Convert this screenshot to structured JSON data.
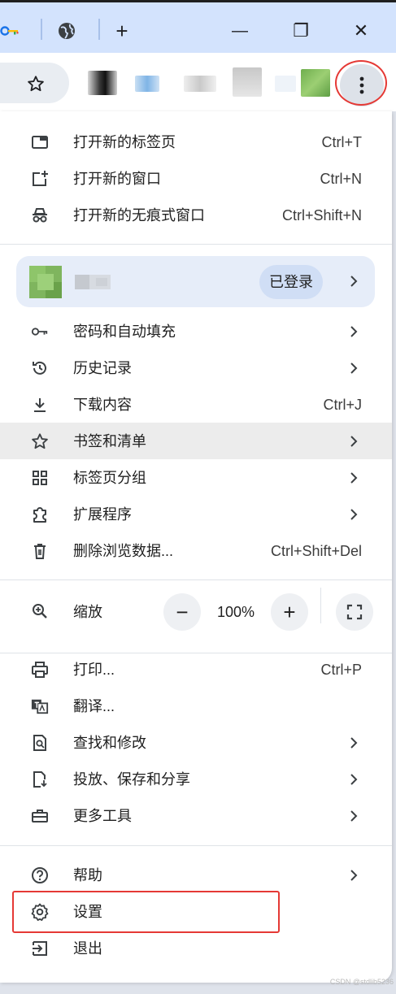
{
  "window_controls": {
    "new_tab": "+",
    "minimize": "—",
    "restore": "❐",
    "close": "✕"
  },
  "menu": {
    "group1": [
      {
        "icon": "new-tab-icon",
        "label": "打开新的标签页",
        "shortcut": "Ctrl+T"
      },
      {
        "icon": "new-window-icon",
        "label": "打开新的窗口",
        "shortcut": "Ctrl+N"
      },
      {
        "icon": "incognito-icon",
        "label": "打开新的无痕式窗口",
        "shortcut": "Ctrl+Shift+N"
      }
    ],
    "profile": {
      "status": "已登录"
    },
    "group2": [
      {
        "icon": "key-icon",
        "label": "密码和自动填充",
        "shortcut": ""
      },
      {
        "icon": "history-icon",
        "label": "历史记录",
        "shortcut": ""
      },
      {
        "icon": "download-icon",
        "label": "下载内容",
        "shortcut": "Ctrl+J"
      },
      {
        "icon": "star-icon",
        "label": "书签和清单",
        "shortcut": ""
      },
      {
        "icon": "tab-groups-icon",
        "label": "标签页分组",
        "shortcut": ""
      },
      {
        "icon": "extension-icon",
        "label": "扩展程序",
        "shortcut": ""
      },
      {
        "icon": "trash-icon",
        "label": "删除浏览数据...",
        "shortcut": "Ctrl+Shift+Del"
      }
    ],
    "zoom": {
      "label": "缩放",
      "minus": "−",
      "value": "100%",
      "plus": "+"
    },
    "group3": [
      {
        "icon": "print-icon",
        "label": "打印...",
        "shortcut": "Ctrl+P"
      },
      {
        "icon": "translate-icon",
        "label": "翻译...",
        "shortcut": ""
      },
      {
        "icon": "find-icon",
        "label": "查找和修改",
        "shortcut": ""
      },
      {
        "icon": "cast-icon",
        "label": "投放、保存和分享",
        "shortcut": ""
      },
      {
        "icon": "toolbox-icon",
        "label": "更多工具",
        "shortcut": ""
      }
    ],
    "group4": [
      {
        "icon": "help-icon",
        "label": "帮助",
        "shortcut": ""
      },
      {
        "icon": "settings-icon",
        "label": "设置",
        "shortcut": ""
      },
      {
        "icon": "exit-icon",
        "label": "退出",
        "shortcut": ""
      }
    ]
  },
  "watermark": "CSDN @stdlib5236",
  "colors": {
    "tab_strip": "#d3e3fd",
    "hover_row": "#ececec",
    "profile_card": "#e6edf9",
    "annotation_red": "#e53935"
  }
}
